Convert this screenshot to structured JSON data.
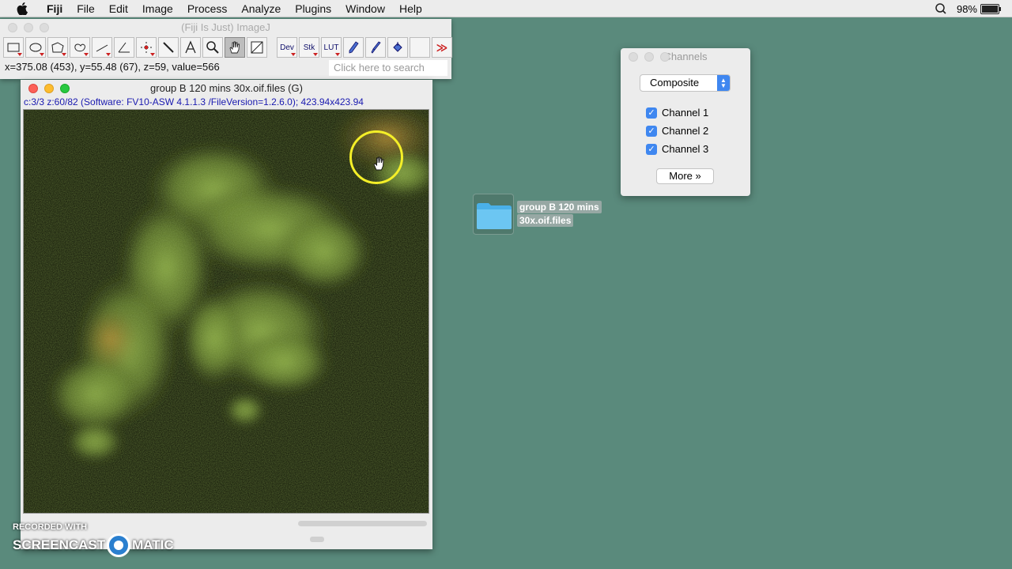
{
  "menubar": {
    "app": "Fiji",
    "items": [
      "File",
      "Edit",
      "Image",
      "Process",
      "Analyze",
      "Plugins",
      "Window",
      "Help"
    ],
    "battery": "98%",
    "battery_level": 0.98
  },
  "fiji_window": {
    "title": "(Fiji Is Just) ImageJ",
    "tools": [
      {
        "name": "rectangle-tool",
        "icon": "rectangle-icon"
      },
      {
        "name": "oval-tool",
        "icon": "oval-icon"
      },
      {
        "name": "polygon-tool",
        "icon": "polygon-icon"
      },
      {
        "name": "freehand-tool",
        "icon": "freehand-icon"
      },
      {
        "name": "line-tool",
        "icon": "line-icon"
      },
      {
        "name": "angle-tool",
        "icon": "angle-icon"
      },
      {
        "name": "point-tool",
        "icon": "point-icon"
      },
      {
        "name": "wand-tool",
        "icon": "wand-icon"
      },
      {
        "name": "text-tool",
        "icon": "text-icon"
      },
      {
        "name": "magnifier-tool",
        "icon": "magnifier-icon"
      },
      {
        "name": "hand-tool",
        "icon": "hand-icon"
      },
      {
        "name": "color-picker-tool",
        "icon": "color-picker-icon"
      }
    ],
    "dev_label": "Dev",
    "stk_label": "Stk",
    "lut_label": "LUT",
    "status": "x=375.08 (453), y=55.48 (67), z=59, value=566",
    "search_placeholder": "Click here to search"
  },
  "image_window": {
    "title": "group B 120 mins 30x.oif.files (G)",
    "info": "c:3/3 z:60/82 (Software: FV10-ASW 4.1.1.3 /FileVersion=1.2.6.0); 423.94x423.94"
  },
  "channels_panel": {
    "title": "Channels",
    "mode": "Composite",
    "channels": [
      {
        "label": "Channel 1",
        "checked": true
      },
      {
        "label": "Channel 2",
        "checked": true
      },
      {
        "label": "Channel 3",
        "checked": true
      }
    ],
    "more_label": "More »"
  },
  "desktop_folder": {
    "label_line1": "group B 120 mins",
    "label_line2": "30x.oif.files"
  },
  "watermark": {
    "line1": "RECORDED WITH",
    "left": "SCREENCAST",
    "right": "MATIC"
  },
  "colors": {
    "desktop": "#5a8a7c",
    "highlight_ring": "#f4ef28",
    "accent": "#3f87f0"
  }
}
